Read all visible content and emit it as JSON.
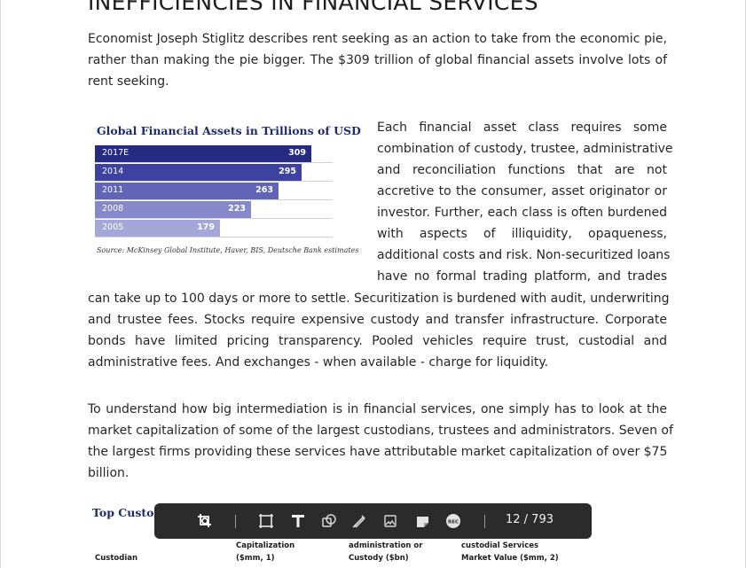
{
  "document": {
    "heading": "INEFFICIENCIES IN FINANCIAL SERVICES",
    "para1_lines": [
      "Economist Joseph Stiglitz describes rent seeking as an action to take from the economic pie,",
      "rather than making the pie bigger. The $309 trillion of global financial assets involve lots of",
      "rent seeking."
    ],
    "para2_side_lines": [
      "Each financial asset class requires some",
      "combination of custody, trustee, administrative",
      "and reconciliation functions that are not",
      "accretive to the consumer, asset originator or",
      "investor. Further, each class is often burdened",
      "with aspects of illiquidity, opaqueness,",
      "additional costs and risk. Non-securitized loans",
      "have no formal trading platform, and trades"
    ],
    "para2_full_lines": [
      "can take up to 100 days or more to settle. Securitization is burdened with audit, underwriting",
      "and trustee fees. Stocks require expensive custody and transfer infrastructure. Corporate",
      "bonds have limited pricing transparency. Pooled vehicles require trust, custodial and",
      "administrative fees. And exchanges - when available - charge for liquidity."
    ],
    "para3_lines": [
      "To understand how big intermediation is in financial services, one simply has to look at the",
      "market capitalization of some of the largest custodians, trustees and administrators. Seven of",
      "the largest firms providing these services have attributable market capitalization of over $75",
      "billion."
    ],
    "table_title": "Top Custodi",
    "table_headers": {
      "col1": "Custodian",
      "col2_line1": "Capitalization",
      "col2_line2": "($mm, 1)",
      "col3_line1": "administration or",
      "col3_line2": "Custody ($bn)",
      "col4_line1": "custodial Services",
      "col4_line2": "Market Value ($mm, 2)"
    }
  },
  "chart_data": {
    "type": "bar",
    "orientation": "horizontal",
    "title": "Global Financial Assets in Trillions of USD",
    "categories": [
      "2017E",
      "2014",
      "2011",
      "2008",
      "2005"
    ],
    "values": [
      309,
      295,
      263,
      223,
      179
    ],
    "xlim": [
      0,
      340
    ],
    "colors": [
      "#262a80",
      "#3d41a0",
      "#6065b8",
      "#8589c9",
      "#a4a7d7"
    ],
    "source": "Source: McKinsey Global Institute, Haver, BIS, Deutsche Bank estimates"
  },
  "toolbar": {
    "page_indicator": "12 / 793",
    "icons": [
      "crop-search-icon",
      "crop-icon",
      "text-icon",
      "shapes-icon",
      "draw-icon",
      "image-icon",
      "note-icon",
      "record-icon"
    ],
    "record_label": "REC"
  }
}
